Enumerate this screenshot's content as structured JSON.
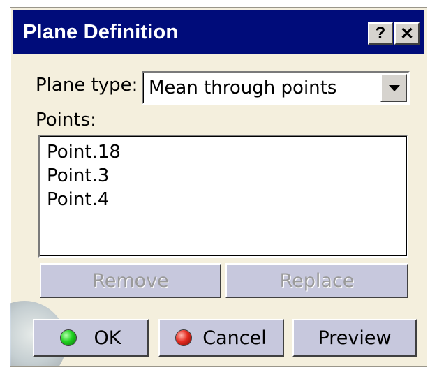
{
  "dialog": {
    "title": "Plane Definition",
    "help_label": "?",
    "close_label": "✕"
  },
  "plane_type": {
    "label": "Plane type:",
    "value": "Mean through points"
  },
  "points": {
    "label": "Points:",
    "items": [
      "Point.18",
      "Point.3",
      "Point.4"
    ]
  },
  "list_buttons": {
    "remove": "Remove",
    "replace": "Replace"
  },
  "footer": {
    "ok": "OK",
    "cancel": "Cancel",
    "preview": "Preview"
  },
  "colors": {
    "title_bar": "#000c7a",
    "dialog_bg": "#f4efdd",
    "ok_led": "#1fd11f",
    "cancel_led": "#e42a1f"
  }
}
